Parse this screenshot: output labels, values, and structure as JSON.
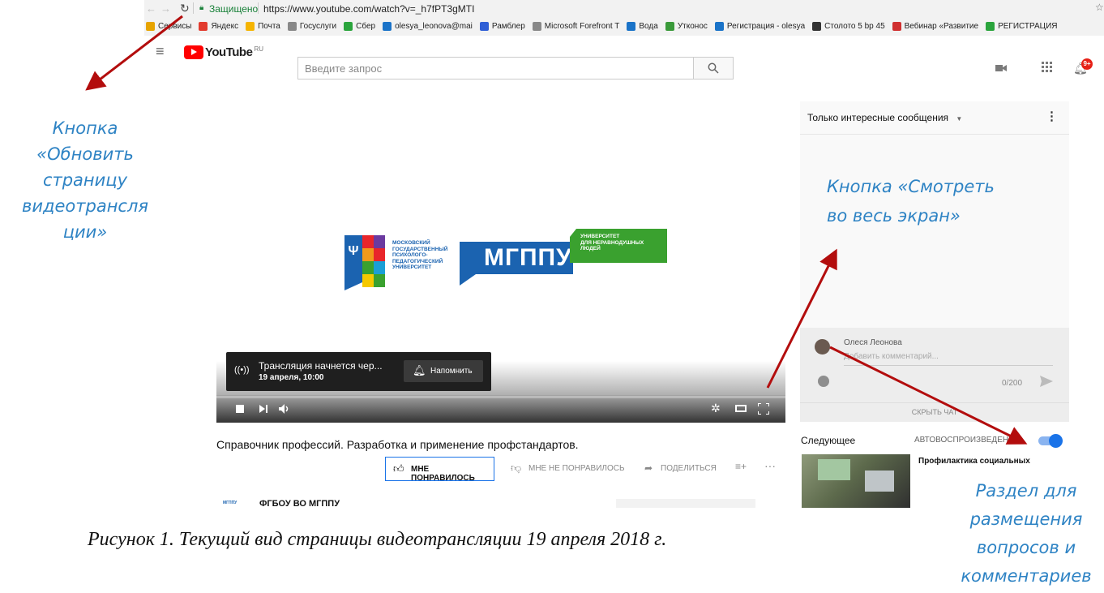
{
  "browser": {
    "secure_label": "Защищено",
    "url": "https://www.youtube.com/watch?v=_h7fPT3gMTI",
    "bookmarks": [
      {
        "label": "Сервисы",
        "color": "#e7a400"
      },
      {
        "label": "Яндекс",
        "color": "#e23b2e"
      },
      {
        "label": "Почта",
        "color": "#f5b400"
      },
      {
        "label": "Госуслуги",
        "color": "#888888"
      },
      {
        "label": "Сбер",
        "color": "#2aa43c"
      },
      {
        "label": "olesya_leonova@mai",
        "color": "#1a73c8"
      },
      {
        "label": "Рамблер",
        "color": "#2f5fd6"
      },
      {
        "label": "Microsoft Forefront T",
        "color": "#888888"
      },
      {
        "label": "Вода",
        "color": "#1a73c8"
      },
      {
        "label": "Утконос",
        "color": "#3a9a3a"
      },
      {
        "label": "Регистрация - olesya",
        "color": "#1a73c8"
      },
      {
        "label": "Столото 5 bp 45",
        "color": "#333333"
      },
      {
        "label": "Вебинар «Развитие",
        "color": "#d03030"
      },
      {
        "label": "РЕГИСТРАЦИЯ",
        "color": "#2aa43c"
      }
    ]
  },
  "youtube": {
    "logo_text": "YouTube",
    "region": "RU",
    "search_placeholder": "Введите запрос",
    "notifications_badge": "9+"
  },
  "player": {
    "logo_left_lines": [
      "МОСКОВСКИЙ",
      "ГОСУДАРСТВЕННЫЙ",
      "ПСИХОЛОГО-",
      "ПЕДАГОГИЧЕСКИЙ",
      "УНИВЕРСИТЕТ"
    ],
    "logo_main": "МГППУ",
    "logo_right_lines": [
      "УНИВЕРСИТЕТ",
      "ДЛЯ НЕРАВНОДУШНЫХ",
      "ЛЮДЕЙ"
    ],
    "toast_title": "Трансляция начнется чер...",
    "toast_time": "19 апреля, 10:00",
    "remind_label": "Напомнить"
  },
  "video": {
    "title": "Справочник профессий. Разработка и применение профстандартов.",
    "like_label": "МНЕ ПОНРАВИЛОСЬ",
    "dislike_label": "МНЕ НЕ ПОНРАВИЛОСЬ",
    "share_label": "ПОДЕЛИТЬСЯ",
    "channel_name": "ФГБОУ ВО МГППУ",
    "channel_logo": "МГППУ"
  },
  "chat": {
    "filter_label": "Только интересные сообщения",
    "user_name": "Олеся Леонова",
    "comment_placeholder": "Добавить комментарий...",
    "char_count": "0/200",
    "hide_chat": "СКРЫТЬ ЧАТ"
  },
  "next": {
    "heading": "Следующее",
    "autoplay_label": "АВТОВОСПРОИЗВЕДЕНИЕ",
    "video_title": "Профилактика социальных"
  },
  "annotations": {
    "refresh_note": [
      "Кнопка",
      "«Обновить",
      "страницу",
      "видеотрансля",
      "ции»"
    ],
    "fullscreen_note": [
      "Кнопка «Смотреть",
      "во весь экран»"
    ],
    "comments_note": [
      "Раздел для",
      "размещения",
      "вопросов и",
      "комментариев"
    ],
    "figure_caption": "Рисунок 1. Текущий вид страницы видеотрансляции 19 апреля 2018 г."
  },
  "colors": {
    "annotation_blue": "#2e83c4",
    "arrow_red": "#b30d0d",
    "youtube_red": "#ff0000",
    "accent_blue": "#1a73e8",
    "logo_blue": "#1b63b0",
    "logo_green": "#3aa12f"
  }
}
